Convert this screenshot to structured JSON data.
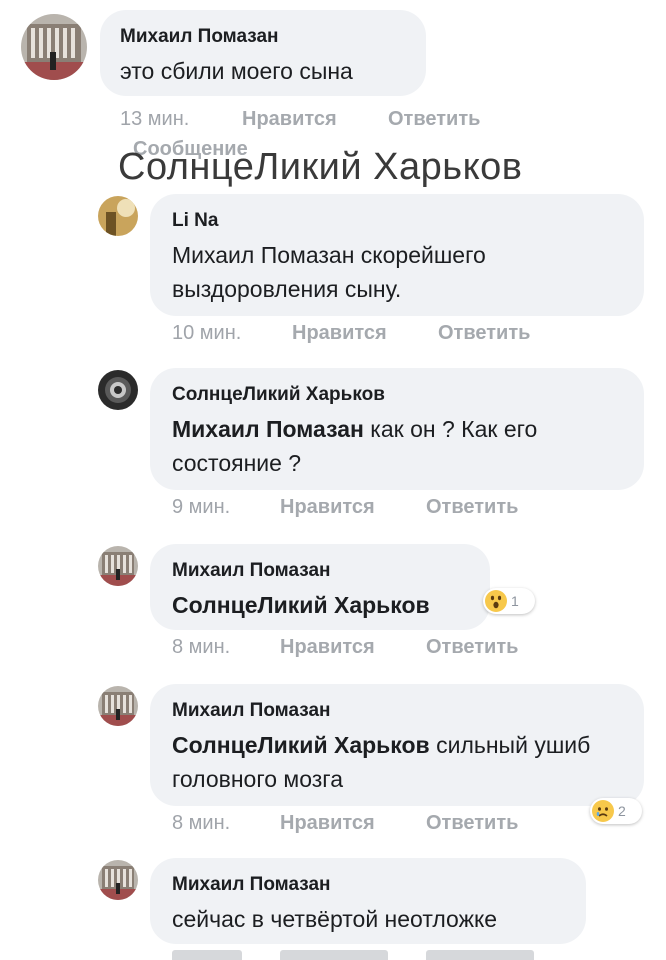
{
  "overlay": {
    "name": "СолнцеЛикий Харьков",
    "partial_label": "Сообщение"
  },
  "comments": [
    {
      "author": "Михаил Помазан",
      "text": "это сбили моего сына",
      "time": "13 мин.",
      "like": "Нравится",
      "reply": "Ответить",
      "avatar": "building-avatar"
    },
    {
      "author": "Li Na",
      "text": "Михаил Помазан скорейшего выздоровления сыну.",
      "time": "10 мин.",
      "like": "Нравится",
      "reply": "Ответить",
      "avatar": "golden-avatar"
    },
    {
      "author": "СолнцеЛикий Харьков",
      "mention": "Михаил Помазан",
      "text": " как он ? Как его состояние ?",
      "time": "9 мин.",
      "like": "Нравится",
      "reply": "Ответить",
      "avatar": "dark-emblem-avatar"
    },
    {
      "author": "Михаил Помазан",
      "mention": "СолнцеЛикий Харьков",
      "text": "",
      "time": "8 мин.",
      "like": "Нравится",
      "reply": "Ответить",
      "avatar": "building-avatar",
      "reaction": {
        "type": "wow-emoji-icon",
        "count": "1"
      }
    },
    {
      "author": "Михаил Помазан",
      "mention": "СолнцеЛикий Харьков",
      "text": " сильный ушиб головного мозга",
      "time": "8 мин.",
      "like": "Нравится",
      "reply": "Ответить",
      "avatar": "building-avatar",
      "reaction": {
        "type": "sad-emoji-icon",
        "count": "2"
      }
    },
    {
      "author": "Михаил Помазан",
      "text": "сейчас в четвёртой неотложке",
      "time": "",
      "like": "",
      "reply": "",
      "avatar": "building-avatar"
    }
  ],
  "colors": {
    "bubble": "#f0f2f5",
    "text": "#1c1e21",
    "meta": "#a0a4aa",
    "reaction_yellow": "#f7c84b"
  }
}
